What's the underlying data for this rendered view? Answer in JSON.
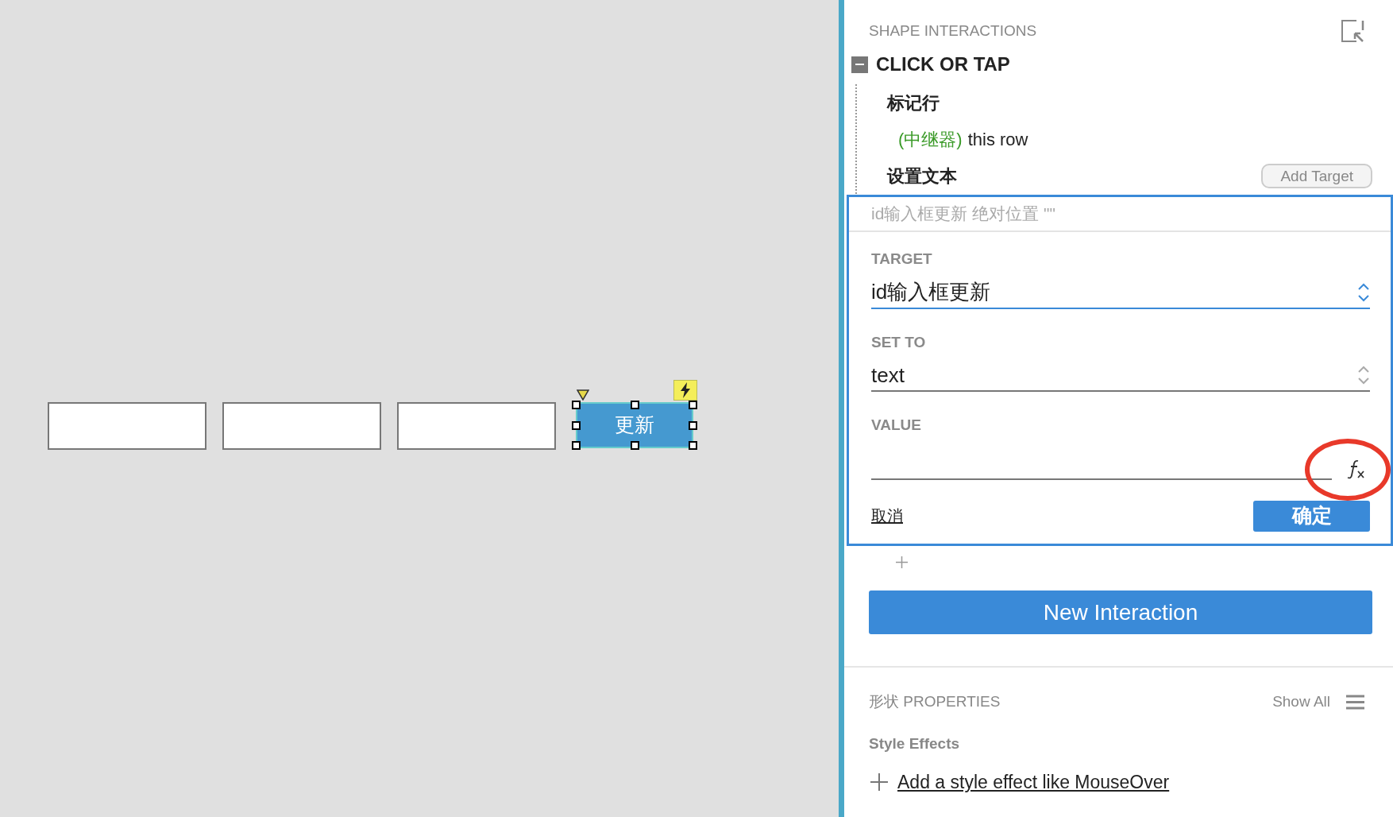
{
  "canvas": {
    "button": "更新"
  },
  "panel": {
    "title": "SHAPE INTERACTIONS",
    "event": {
      "label": "CLICK OR TAP",
      "expanded": true
    },
    "actions": [
      {
        "label": "标记行",
        "target_tag": "(中继器)",
        "target": "this row"
      },
      {
        "label": "设置文本"
      }
    ],
    "add_target": "Add Target",
    "editor": {
      "summary": "id输入框更新 绝对位置 \"\"",
      "fields": [
        {
          "label": "TARGET",
          "kind": "select",
          "value": "id输入框更新",
          "focused": true
        },
        {
          "label": "SET TO",
          "kind": "select",
          "value": "text",
          "focused": false
        },
        {
          "label": "VALUE",
          "kind": "formula"
        }
      ],
      "cancel": "取消",
      "ok": "确定"
    },
    "new_interaction": "New Interaction",
    "properties": {
      "title": "形状 PROPERTIES",
      "show_all": "Show All",
      "section": "Style Effects",
      "add_effect": "Add a style effect like MouseOver"
    }
  }
}
